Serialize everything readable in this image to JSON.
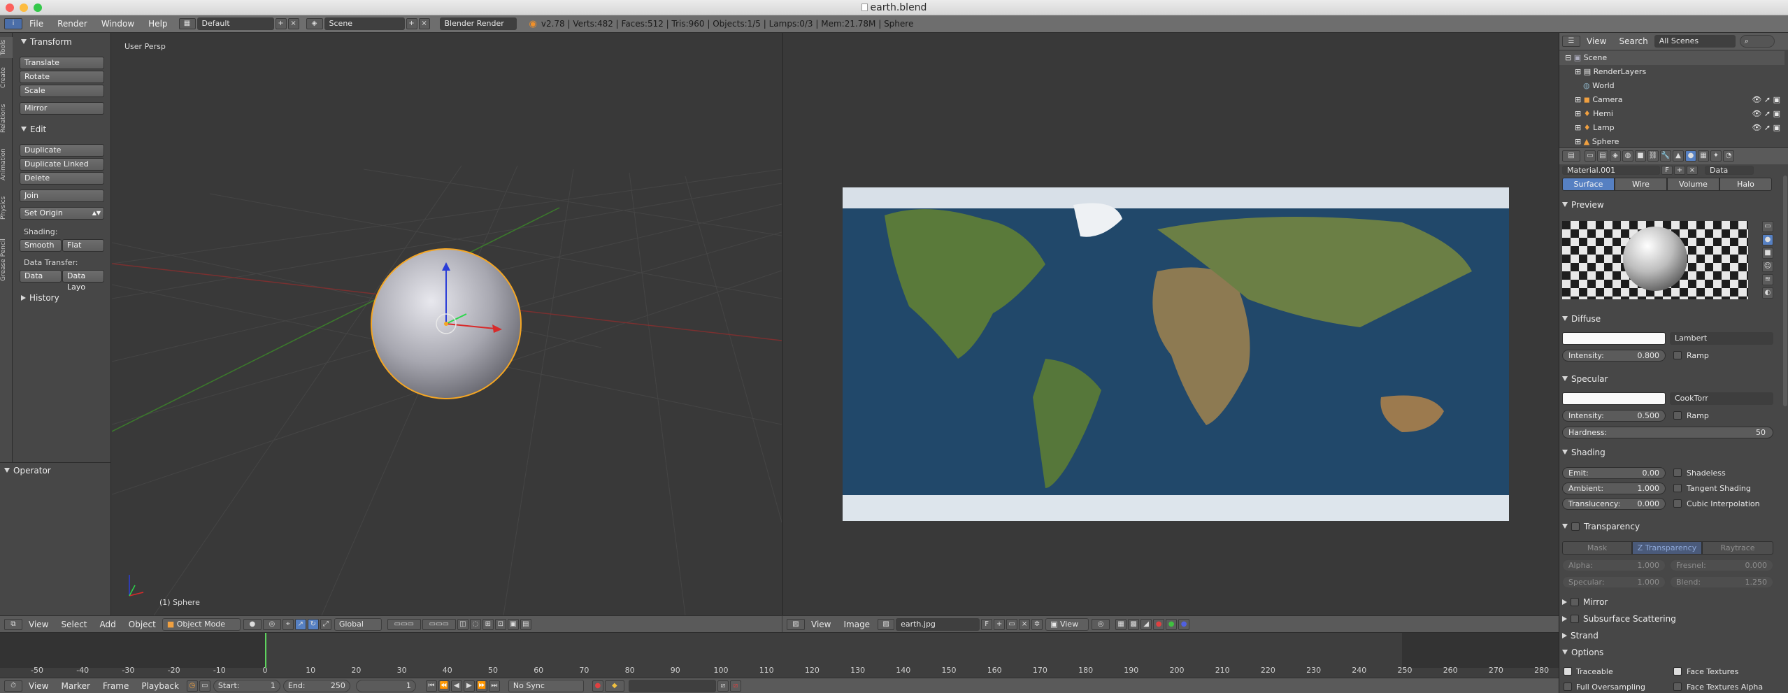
{
  "window": {
    "title": "earth.blend"
  },
  "info": {
    "menus": [
      "File",
      "Render",
      "Window",
      "Help"
    ],
    "layout": "Default",
    "scene": "Scene",
    "engine": "Blender Render",
    "stats": "v2.78 | Verts:482 | Faces:512 | Tris:960 | Objects:1/5 | Lamps:0/3 | Mem:21.78M | Sphere"
  },
  "tool_tabs": [
    "Tools",
    "Create",
    "Relations",
    "Animation",
    "Physics",
    "Grease Pencil"
  ],
  "toolshelf": {
    "transform_header": "Transform",
    "translate": "Translate",
    "rotate": "Rotate",
    "scale": "Scale",
    "mirror": "Mirror",
    "edit_header": "Edit",
    "duplicate": "Duplicate",
    "duplicate_linked": "Duplicate Linked",
    "delete": "Delete",
    "join": "Join",
    "set_origin": "Set Origin",
    "shading_label": "Shading:",
    "smooth": "Smooth",
    "flat": "Flat",
    "data_transfer_label": "Data Transfer:",
    "data": "Data",
    "data_layout": "Data Layo",
    "history_header": "History",
    "operator_header": "Operator"
  },
  "viewport": {
    "view_label": "User Persp",
    "object_label": "(1) Sphere"
  },
  "v3d_header": {
    "menus": [
      "View",
      "Select",
      "Add",
      "Object"
    ],
    "mode": "Object Mode",
    "orientation": "Global"
  },
  "image_header": {
    "menus": [
      "View",
      "Image"
    ],
    "image_name": "earth.jpg",
    "fake_user": "F",
    "view_mode": "View"
  },
  "timeline": {
    "ticks": [
      "-50",
      "-40",
      "-30",
      "-20",
      "-10",
      "0",
      "10",
      "20",
      "30",
      "40",
      "50",
      "60",
      "70",
      "80",
      "90",
      "100",
      "110",
      "120",
      "130",
      "140",
      "150",
      "160",
      "170",
      "180",
      "190",
      "200",
      "210",
      "220",
      "230",
      "240",
      "250",
      "260",
      "270",
      "280"
    ],
    "menus": [
      "View",
      "Marker",
      "Frame",
      "Playback"
    ],
    "start_label": "Start:",
    "start": "1",
    "end_label": "End:",
    "end": "250",
    "current": "1",
    "sync": "No Sync"
  },
  "outliner": {
    "menus": [
      "View",
      "Search"
    ],
    "filter": "All Scenes",
    "items": [
      "Scene",
      "RenderLayers",
      "World",
      "Camera",
      "Hemi",
      "Lamp",
      "Sphere"
    ]
  },
  "properties": {
    "material_name": "Material.001",
    "fake_user": "F",
    "link": "Data",
    "tabs": [
      "Surface",
      "Wire",
      "Volume",
      "Halo"
    ],
    "preview_header": "Preview",
    "diffuse": {
      "header": "Diffuse",
      "shader": "Lambert",
      "intensity_label": "Intensity:",
      "intensity": "0.800",
      "ramp": "Ramp"
    },
    "specular": {
      "header": "Specular",
      "shader": "CookTorr",
      "intensity_label": "Intensity:",
      "intensity": "0.500",
      "ramp": "Ramp",
      "hardness_label": "Hardness:",
      "hardness": "50"
    },
    "shading": {
      "header": "Shading",
      "emit_label": "Emit:",
      "emit": "0.00",
      "ambient_label": "Ambient:",
      "ambient": "1.000",
      "translucency_label": "Translucency:",
      "translucency": "0.000",
      "shadeless": "Shadeless",
      "tangent": "Tangent Shading",
      "cubic": "Cubic Interpolation"
    },
    "transparency": {
      "header": "Transparency",
      "tabs": [
        "Mask",
        "Z Transparency",
        "Raytrace"
      ],
      "alpha_label": "Alpha:",
      "alpha": "1.000",
      "fresnel_label": "Fresnel:",
      "fresnel": "0.000",
      "specular_label": "Specular:",
      "specular": "1.000",
      "blend_label": "Blend:",
      "blend": "1.250"
    },
    "mirror_header": "Mirror",
    "sss_header": "Subsurface Scattering",
    "strand_header": "Strand",
    "options": {
      "header": "Options",
      "traceable": "Traceable",
      "face_textures": "Face Textures",
      "full_oversampling": "Full Oversampling",
      "face_textures_alpha": "Face Textures Alpha"
    }
  },
  "colors": {
    "accent": "#5680c2",
    "selection": "#f5a623",
    "current_frame": "#5ed35e"
  }
}
